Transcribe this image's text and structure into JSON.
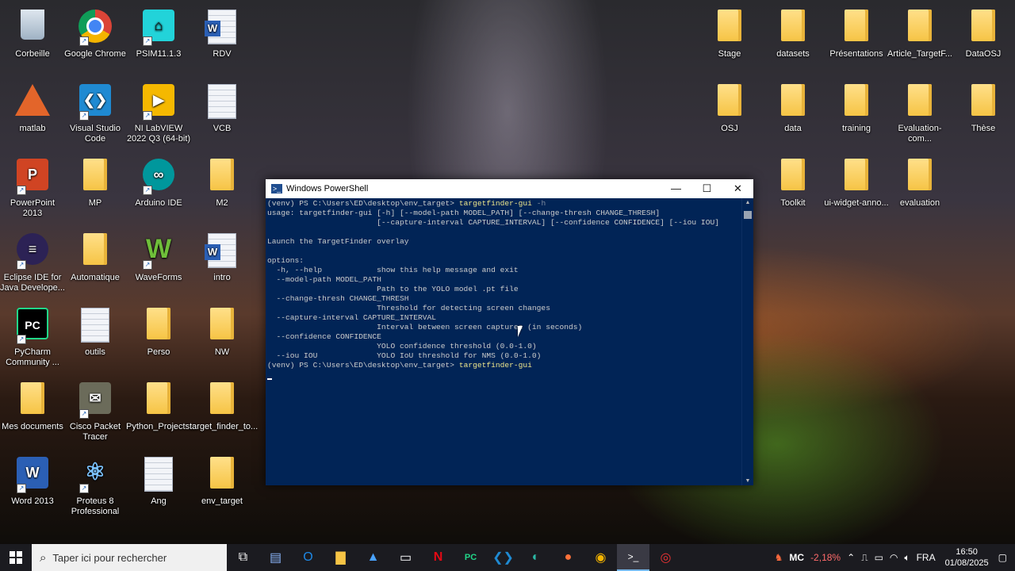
{
  "desktop": {
    "icons_left": [
      {
        "label": "Corbeille",
        "icon": "recycle-bin-icon"
      },
      {
        "label": "Google Chrome",
        "icon": "chrome-icon"
      },
      {
        "label": "PSIM11.1.3",
        "icon": "psim-icon"
      },
      {
        "label": "RDV",
        "icon": "word-doc-icon"
      },
      {
        "label": "matlab",
        "icon": "matlab-icon"
      },
      {
        "label": "Visual Studio Code",
        "icon": "vscode-icon"
      },
      {
        "label": "NI LabVIEW 2022 Q3 (64-bit)",
        "icon": "labview-icon"
      },
      {
        "label": "VCB",
        "icon": "text-doc-icon"
      },
      {
        "label": "PowerPoint 2013",
        "icon": "powerpoint-icon"
      },
      {
        "label": "MP",
        "icon": "folder-icon"
      },
      {
        "label": "Arduino IDE",
        "icon": "arduino-icon"
      },
      {
        "label": "M2",
        "icon": "folder-icon"
      },
      {
        "label": "Eclipse IDE for Java Develope...",
        "icon": "eclipse-icon"
      },
      {
        "label": "Automatique",
        "icon": "folder-icon"
      },
      {
        "label": "WaveForms",
        "icon": "waveforms-icon"
      },
      {
        "label": "intro",
        "icon": "word-doc-icon"
      },
      {
        "label": "PyCharm Community ...",
        "icon": "pycharm-icon"
      },
      {
        "label": "outils",
        "icon": "text-doc-icon"
      },
      {
        "label": "Perso",
        "icon": "folder-icon"
      },
      {
        "label": "NW",
        "icon": "folder-icon"
      },
      {
        "label": "Mes documents",
        "icon": "folder-icon"
      },
      {
        "label": "Cisco Packet Tracer",
        "icon": "cisco-icon"
      },
      {
        "label": "Python_Projects...",
        "icon": "folder-icon"
      },
      {
        "label": "target_finder_to...",
        "icon": "folder-icon"
      },
      {
        "label": "Word 2013",
        "icon": "word-icon"
      },
      {
        "label": "Proteus 8 Professional",
        "icon": "proteus-icon"
      },
      {
        "label": "Ang",
        "icon": "text-doc-icon"
      },
      {
        "label": "env_target",
        "icon": "folder-icon"
      }
    ],
    "icons_right": [
      {
        "label": "Stage"
      },
      {
        "label": "datasets"
      },
      {
        "label": "Présentations"
      },
      {
        "label": "Article_TargetF..."
      },
      {
        "label": "DataOSJ"
      },
      {
        "label": "OSJ"
      },
      {
        "label": "data"
      },
      {
        "label": "training"
      },
      {
        "label": "Evaluation-com..."
      },
      {
        "label": "Thèse"
      },
      {
        "label": "Toolkit"
      },
      {
        "label": "ui-widget-anno..."
      },
      {
        "label": "evaluation"
      }
    ]
  },
  "powershell": {
    "title": "Windows PowerShell",
    "prompt": "(venv) PS C:\\Users\\ED\\desktop\\env_target> ",
    "cmd1": "targetfinder-gui",
    "cmd1_arg": " -h",
    "lines": [
      "usage: targetfinder-gui [-h] [--model-path MODEL_PATH] [--change-thresh CHANGE_THRESH]",
      "                        [--capture-interval CAPTURE_INTERVAL] [--confidence CONFIDENCE] [--iou IOU]",
      "",
      "Launch the TargetFinder overlay",
      "",
      "options:",
      "  -h, --help            show this help message and exit",
      "  --model-path MODEL_PATH",
      "                        Path to the YOLO model .pt file",
      "  --change-thresh CHANGE_THRESH",
      "                        Threshold for detecting screen changes",
      "  --capture-interval CAPTURE_INTERVAL",
      "                        Interval between screen captures (in seconds)",
      "  --confidence CONFIDENCE",
      "                        YOLO confidence threshold (0.0-1.0)",
      "  --iou IOU             YOLO IoU threshold for NMS (0.0-1.0)"
    ],
    "cmd2": "targetfinder-gui"
  },
  "taskbar": {
    "search_placeholder": "Taper ici pour rechercher",
    "stock_label": "MC",
    "stock_change": "-2,18%",
    "language": "FRA",
    "time": "16:50",
    "date": "01/08/2025"
  }
}
